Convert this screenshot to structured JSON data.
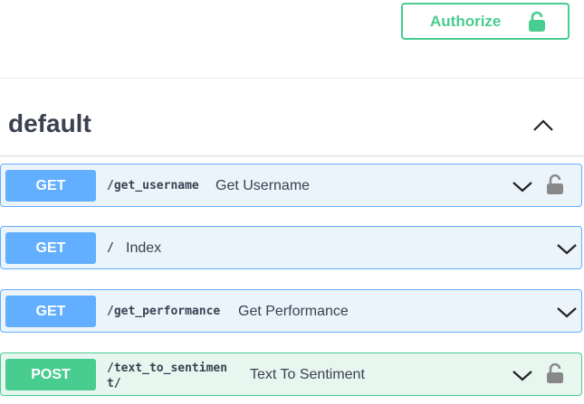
{
  "header": {
    "authorize_label": "Authorize",
    "authorize_icon": "lock-icon",
    "accent_color": "#49cc90"
  },
  "section": {
    "title": "default",
    "state_icon": "chevron-up-icon"
  },
  "operations": [
    {
      "method": "GET",
      "path": "/get_username",
      "summary": "Get Username",
      "locked": true,
      "color": "#61affe"
    },
    {
      "method": "GET",
      "path": "/",
      "summary": "Index",
      "locked": false,
      "color": "#61affe"
    },
    {
      "method": "GET",
      "path": "/get_performance",
      "summary": "Get Performance",
      "locked": false,
      "color": "#61affe"
    },
    {
      "method": "POST",
      "path": "/text_to_sentiment/",
      "summary": "Text To Sentiment",
      "locked": true,
      "color": "#49cc90"
    }
  ]
}
